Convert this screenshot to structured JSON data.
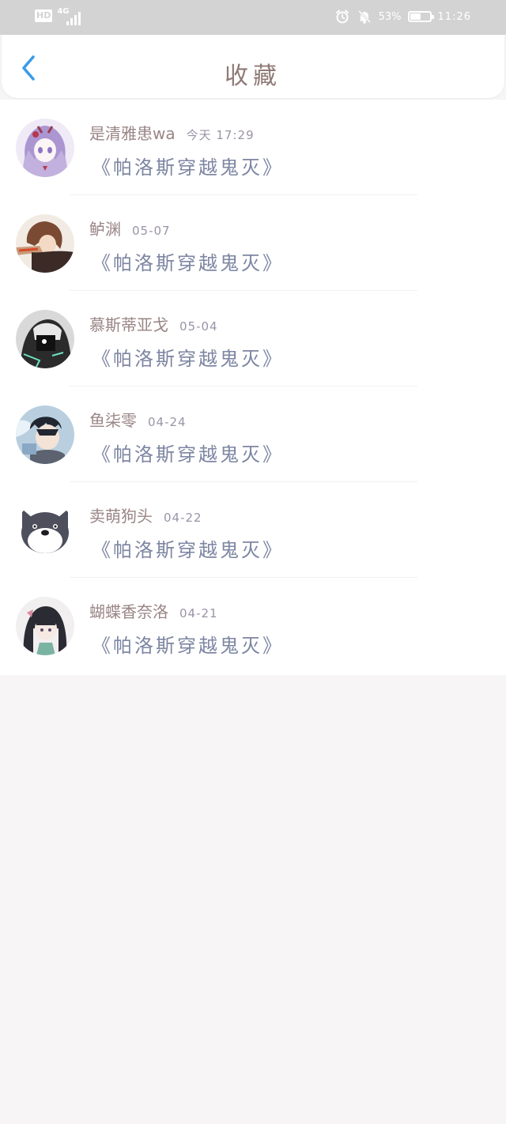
{
  "status_bar": {
    "hd_label": "HD",
    "network_label": "4G",
    "battery_percent": "53%",
    "battery_level": 0.53,
    "time": "11:26",
    "icons": [
      "alarm-icon",
      "bell-muted-icon",
      "battery-icon",
      "signal-icon"
    ]
  },
  "header": {
    "title": "收藏",
    "back_icon": "chevron-left-icon",
    "accent_color": "#3a9be8"
  },
  "favorites": [
    {
      "name": "是清雅患wa",
      "date": "今天 17:29",
      "title": "《帕洛斯穿越鬼灭》"
    },
    {
      "name": "鲈渊",
      "date": "05-07",
      "title": "《帕洛斯穿越鬼灭》"
    },
    {
      "name": "慕斯蒂亚戈",
      "date": "05-04",
      "title": "《帕洛斯穿越鬼灭》"
    },
    {
      "name": "鱼柒零",
      "date": "04-24",
      "title": "《帕洛斯穿越鬼灭》"
    },
    {
      "name": "卖萌狗头",
      "date": "04-22",
      "title": "《帕洛斯穿越鬼灭》"
    },
    {
      "name": "蝴蝶香奈洛",
      "date": "04-21",
      "title": "《帕洛斯穿越鬼灭》"
    }
  ]
}
